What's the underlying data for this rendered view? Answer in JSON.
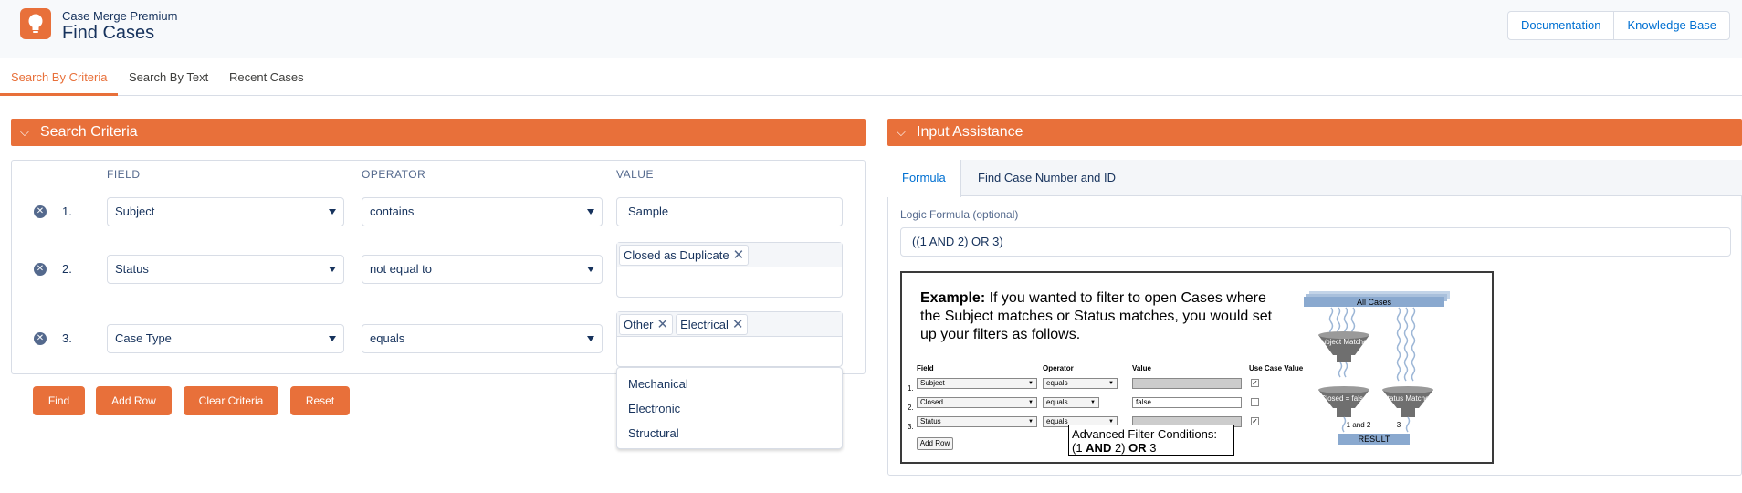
{
  "header": {
    "app_subtitle": "Case Merge Premium",
    "app_title": "Find Cases",
    "buttons": [
      "Documentation",
      "Knowledge Base"
    ],
    "accent_color": "#e8703a"
  },
  "tabs": [
    "Search By Criteria",
    "Search By Text",
    "Recent Cases"
  ],
  "search_criteria": {
    "title": "Search Criteria",
    "columns": [
      "FIELD",
      "OPERATOR",
      "VALUE"
    ],
    "rows": [
      {
        "num": "1.",
        "field": "Subject",
        "operator": "contains",
        "value": "Sample"
      },
      {
        "num": "2.",
        "field": "Status",
        "operator": "not equal to",
        "pills": [
          "Closed as Duplicate"
        ]
      },
      {
        "num": "3.",
        "field": "Case Type",
        "operator": "equals",
        "pills": [
          "Other",
          "Electrical"
        ]
      }
    ],
    "dropdown_options": [
      "Mechanical",
      "Electronic",
      "Structural"
    ],
    "buttons": [
      "Find",
      "Add Row",
      "Clear Criteria",
      "Reset"
    ]
  },
  "input_assistance": {
    "title": "Input Assistance",
    "tabs": [
      "Formula",
      "Find Case Number and ID"
    ],
    "logic_label": "Logic Formula (optional)",
    "logic_value": "((1 AND 2) OR 3)",
    "example": {
      "lead": "Example:",
      "text": "If you wanted to filter to open Cases where the Subject matches or Status matches, you would set up your filters as follows.",
      "columns": [
        "Field",
        "Operator",
        "Value",
        "Use Case Value"
      ],
      "rows": [
        {
          "num": "1.",
          "field": "Subject",
          "operator": "equals",
          "value": ""
        },
        {
          "num": "2.",
          "field": "Closed",
          "operator": "equals",
          "value": "false"
        },
        {
          "num": "3.",
          "field": "Status",
          "operator": "equals",
          "value": ""
        }
      ],
      "add_row": "Add Row",
      "adv_title": "Advanced Filter Conditions:",
      "adv_p1": "(1 ",
      "adv_and": "AND",
      "adv_p2": " 2) ",
      "adv_or": "OR",
      "adv_p3": " 3",
      "diagram": {
        "all_cases": "All Cases",
        "funnel1": "Subject Matches",
        "funnel2": "Closed = false",
        "funnel3": "Status Matches",
        "label_12": "1 and 2",
        "label_3": "3",
        "result": "RESULT"
      }
    }
  }
}
